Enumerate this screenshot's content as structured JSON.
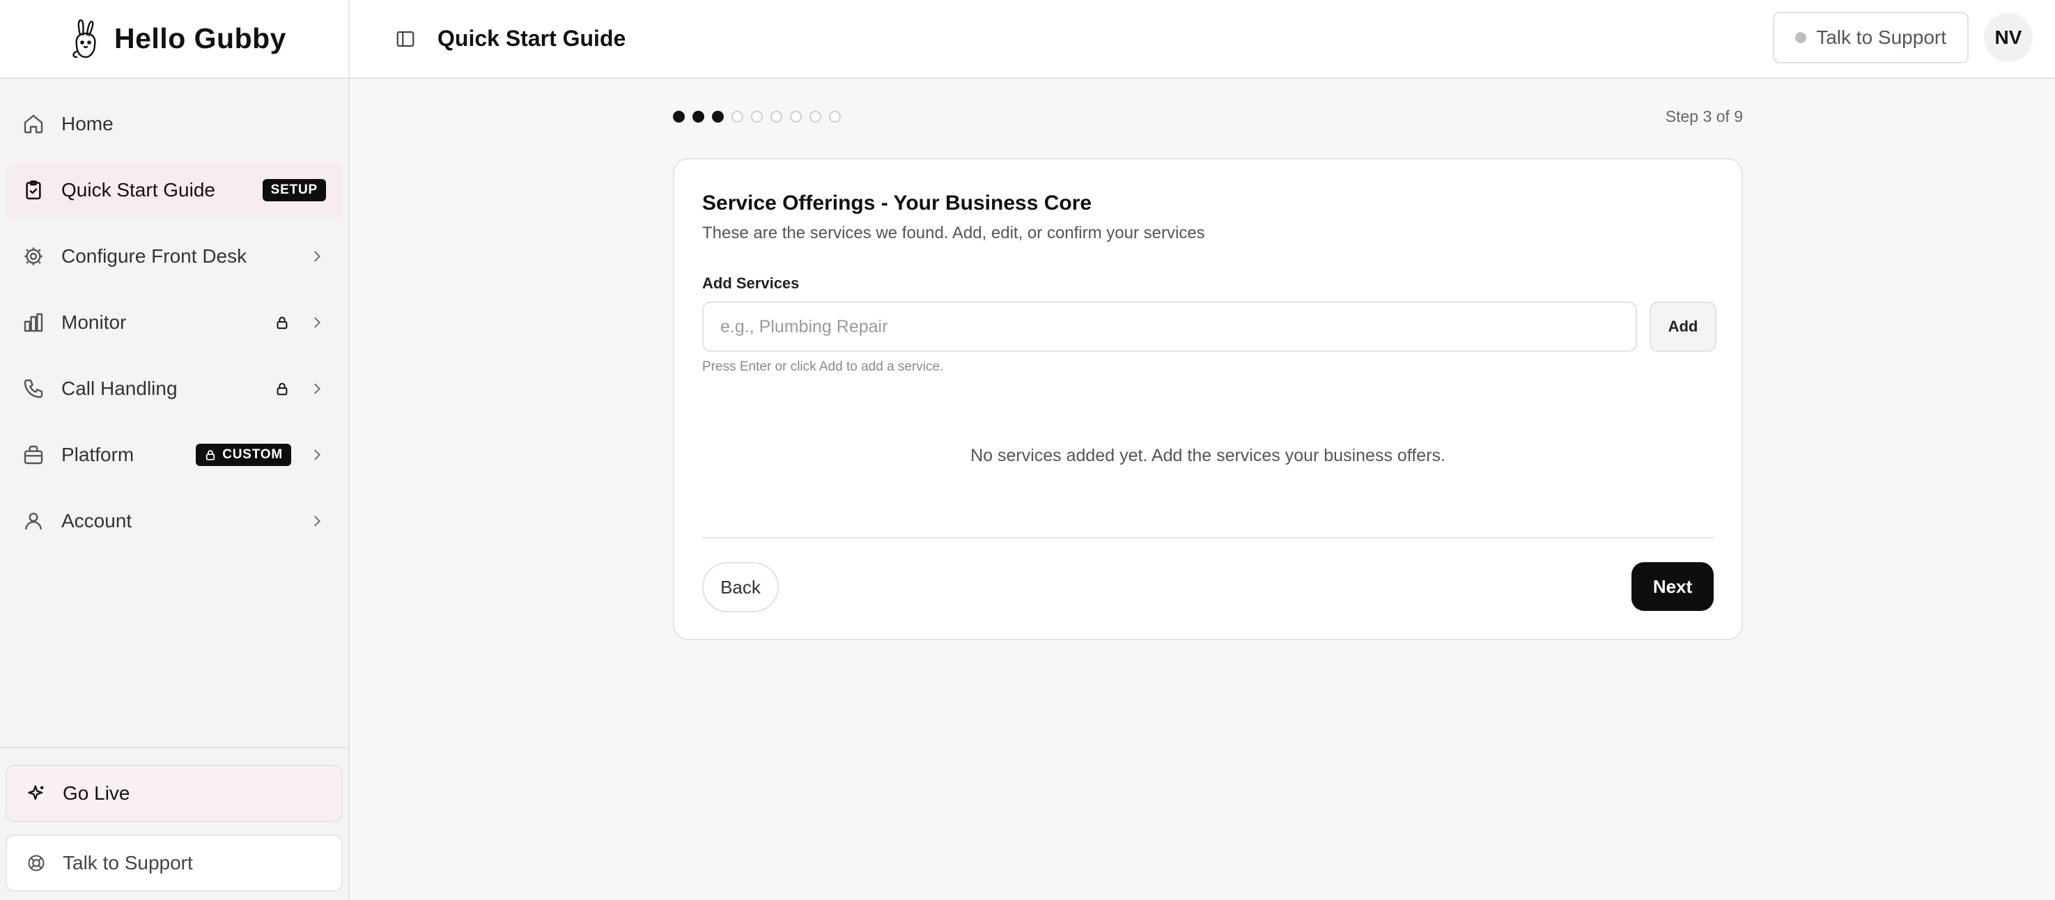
{
  "app": {
    "name": "Hello Gubby"
  },
  "sidebar": {
    "items": [
      {
        "label": "Home",
        "icon": "home-icon"
      },
      {
        "label": "Quick Start Guide",
        "icon": "clipboard-icon",
        "badge": "SETUP",
        "active": true
      },
      {
        "label": "Configure Front Desk",
        "icon": "gear-icon"
      },
      {
        "label": "Monitor",
        "icon": "bar-chart-icon",
        "locked": true
      },
      {
        "label": "Call Handling",
        "icon": "phone-icon",
        "locked": true
      },
      {
        "label": "Platform",
        "icon": "briefcase-icon",
        "badge": "CUSTOM"
      },
      {
        "label": "Account",
        "icon": "user-icon"
      }
    ],
    "bottom": {
      "go_live": "Go Live",
      "support": "Talk to Support"
    }
  },
  "header": {
    "title": "Quick Start Guide",
    "support": "Talk to Support",
    "avatar": "NV"
  },
  "progress": {
    "current": 3,
    "total": 9,
    "text": "Step 3 of 9"
  },
  "card": {
    "title": "Service Offerings - Your Business Core",
    "subtitle": "These are the services we found. Add, edit, or confirm your services",
    "field_label": "Add Services",
    "input_value": "",
    "input_placeholder": "e.g., Plumbing Repair",
    "add_label": "Add",
    "hint": "Press Enter or click Add to add a service.",
    "empty": "No services added yet. Add the services your business offers.",
    "back_label": "Back",
    "next_label": "Next"
  },
  "colors": {
    "accent_bg": "#f8ecf3",
    "primary": "#0e0e0e",
    "status_dot": "#bdbdbd"
  }
}
